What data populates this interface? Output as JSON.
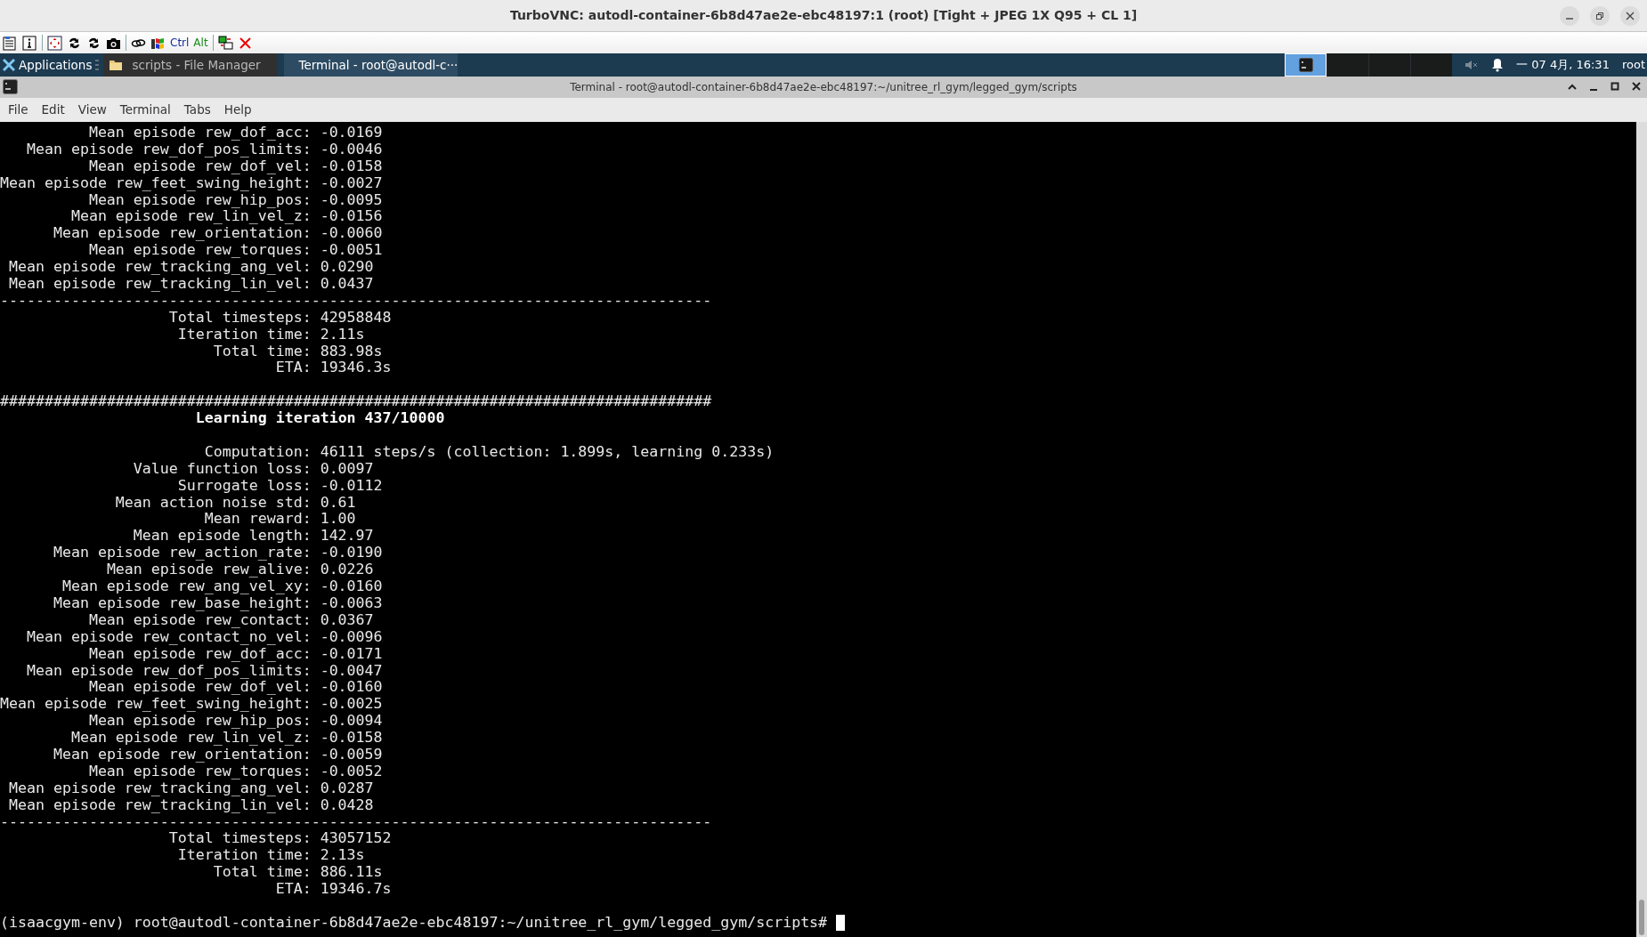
{
  "window": {
    "title": "TurboVNC: autodl-container-6b8d47ae2e-ebc48197:1 (root) [Tight + JPEG 1X Q95 + CL 1]"
  },
  "vnc_toolbar": {
    "ctrl_label": "Ctrl",
    "alt_label": "Alt"
  },
  "taskbar": {
    "menu": "Applications",
    "tasks": [
      {
        "label": "scripts - File Manager",
        "kind": "folder",
        "selected": false
      },
      {
        "label": "Terminal - root@autodl-c···",
        "kind": "terminal",
        "selected": true
      }
    ],
    "workspaces": [
      {
        "selected": true
      },
      {
        "selected": false
      },
      {
        "selected": false
      },
      {
        "selected": false
      }
    ],
    "clock": "一 07 4月, 16:31",
    "user": "root"
  },
  "terminal": {
    "title": "Terminal - root@autodl-container-6b8d47ae2e-ebc48197:~/unitree_rl_gym/legged_gym/scripts",
    "menu": [
      "File",
      "Edit",
      "View",
      "Terminal",
      "Tabs",
      "Help"
    ],
    "lines": [
      {
        "kind": "stat",
        "label": "Mean episode rew_dof_acc:",
        "value": "-0.0169"
      },
      {
        "kind": "stat",
        "label": "Mean episode rew_dof_pos_limits:",
        "value": "-0.0046"
      },
      {
        "kind": "stat",
        "label": "Mean episode rew_dof_vel:",
        "value": "-0.0158"
      },
      {
        "kind": "stat",
        "label": "Mean episode rew_feet_swing_height:",
        "value": "-0.0027"
      },
      {
        "kind": "stat",
        "label": "Mean episode rew_hip_pos:",
        "value": "-0.0095"
      },
      {
        "kind": "stat",
        "label": "Mean episode rew_lin_vel_z:",
        "value": "-0.0156"
      },
      {
        "kind": "stat",
        "label": "Mean episode rew_orientation:",
        "value": "-0.0060"
      },
      {
        "kind": "stat",
        "label": "Mean episode rew_torques:",
        "value": "-0.0051"
      },
      {
        "kind": "stat",
        "label": "Mean episode rew_tracking_ang_vel:",
        "value": "0.0290"
      },
      {
        "kind": "stat",
        "label": "Mean episode rew_tracking_lin_vel:",
        "value": "0.0437"
      },
      {
        "kind": "rule",
        "text": "--------------------------------------------------------------------------------"
      },
      {
        "kind": "stat",
        "label": "Total timesteps:",
        "value": "42958848"
      },
      {
        "kind": "stat",
        "label": "Iteration time:",
        "value": "2.11s"
      },
      {
        "kind": "stat",
        "label": "Total time:",
        "value": "883.98s"
      },
      {
        "kind": "stat",
        "label": "ETA:",
        "value": "19346.3s"
      },
      {
        "kind": "blank"
      },
      {
        "kind": "rule",
        "text": "################################################################################"
      },
      {
        "kind": "heading",
        "text": "Learning iteration 437/10000"
      },
      {
        "kind": "blank"
      },
      {
        "kind": "stat",
        "label": "Computation:",
        "value": "46111 steps/s (collection: 1.899s, learning 0.233s)"
      },
      {
        "kind": "stat",
        "label": "Value function loss:",
        "value": "0.0097"
      },
      {
        "kind": "stat",
        "label": "Surrogate loss:",
        "value": "-0.0112"
      },
      {
        "kind": "stat",
        "label": "Mean action noise std:",
        "value": "0.61"
      },
      {
        "kind": "stat",
        "label": "Mean reward:",
        "value": "1.00"
      },
      {
        "kind": "stat",
        "label": "Mean episode length:",
        "value": "142.97"
      },
      {
        "kind": "stat",
        "label": "Mean episode rew_action_rate:",
        "value": "-0.0190"
      },
      {
        "kind": "stat",
        "label": "Mean episode rew_alive:",
        "value": "0.0226"
      },
      {
        "kind": "stat",
        "label": "Mean episode rew_ang_vel_xy:",
        "value": "-0.0160"
      },
      {
        "kind": "stat",
        "label": "Mean episode rew_base_height:",
        "value": "-0.0063"
      },
      {
        "kind": "stat",
        "label": "Mean episode rew_contact:",
        "value": "0.0367"
      },
      {
        "kind": "stat",
        "label": "Mean episode rew_contact_no_vel:",
        "value": "-0.0096"
      },
      {
        "kind": "stat",
        "label": "Mean episode rew_dof_acc:",
        "value": "-0.0171"
      },
      {
        "kind": "stat",
        "label": "Mean episode rew_dof_pos_limits:",
        "value": "-0.0047"
      },
      {
        "kind": "stat",
        "label": "Mean episode rew_dof_vel:",
        "value": "-0.0160"
      },
      {
        "kind": "stat",
        "label": "Mean episode rew_feet_swing_height:",
        "value": "-0.0025"
      },
      {
        "kind": "stat",
        "label": "Mean episode rew_hip_pos:",
        "value": "-0.0094"
      },
      {
        "kind": "stat",
        "label": "Mean episode rew_lin_vel_z:",
        "value": "-0.0158"
      },
      {
        "kind": "stat",
        "label": "Mean episode rew_orientation:",
        "value": "-0.0059"
      },
      {
        "kind": "stat",
        "label": "Mean episode rew_torques:",
        "value": "-0.0052"
      },
      {
        "kind": "stat",
        "label": "Mean episode rew_tracking_ang_vel:",
        "value": "0.0287"
      },
      {
        "kind": "stat",
        "label": "Mean episode rew_tracking_lin_vel:",
        "value": "0.0428"
      },
      {
        "kind": "rule",
        "text": "--------------------------------------------------------------------------------"
      },
      {
        "kind": "stat",
        "label": "Total timesteps:",
        "value": "43057152"
      },
      {
        "kind": "stat",
        "label": "Iteration time:",
        "value": "2.13s"
      },
      {
        "kind": "stat",
        "label": "Total time:",
        "value": "886.11s"
      },
      {
        "kind": "stat",
        "label": "ETA:",
        "value": "19346.7s"
      },
      {
        "kind": "blank"
      },
      {
        "kind": "prompt",
        "text": "(isaacgym-env) root@autodl-container-6b8d47ae2e-ebc48197:~/unitree_rl_gym/legged_gym/scripts#"
      }
    ]
  }
}
